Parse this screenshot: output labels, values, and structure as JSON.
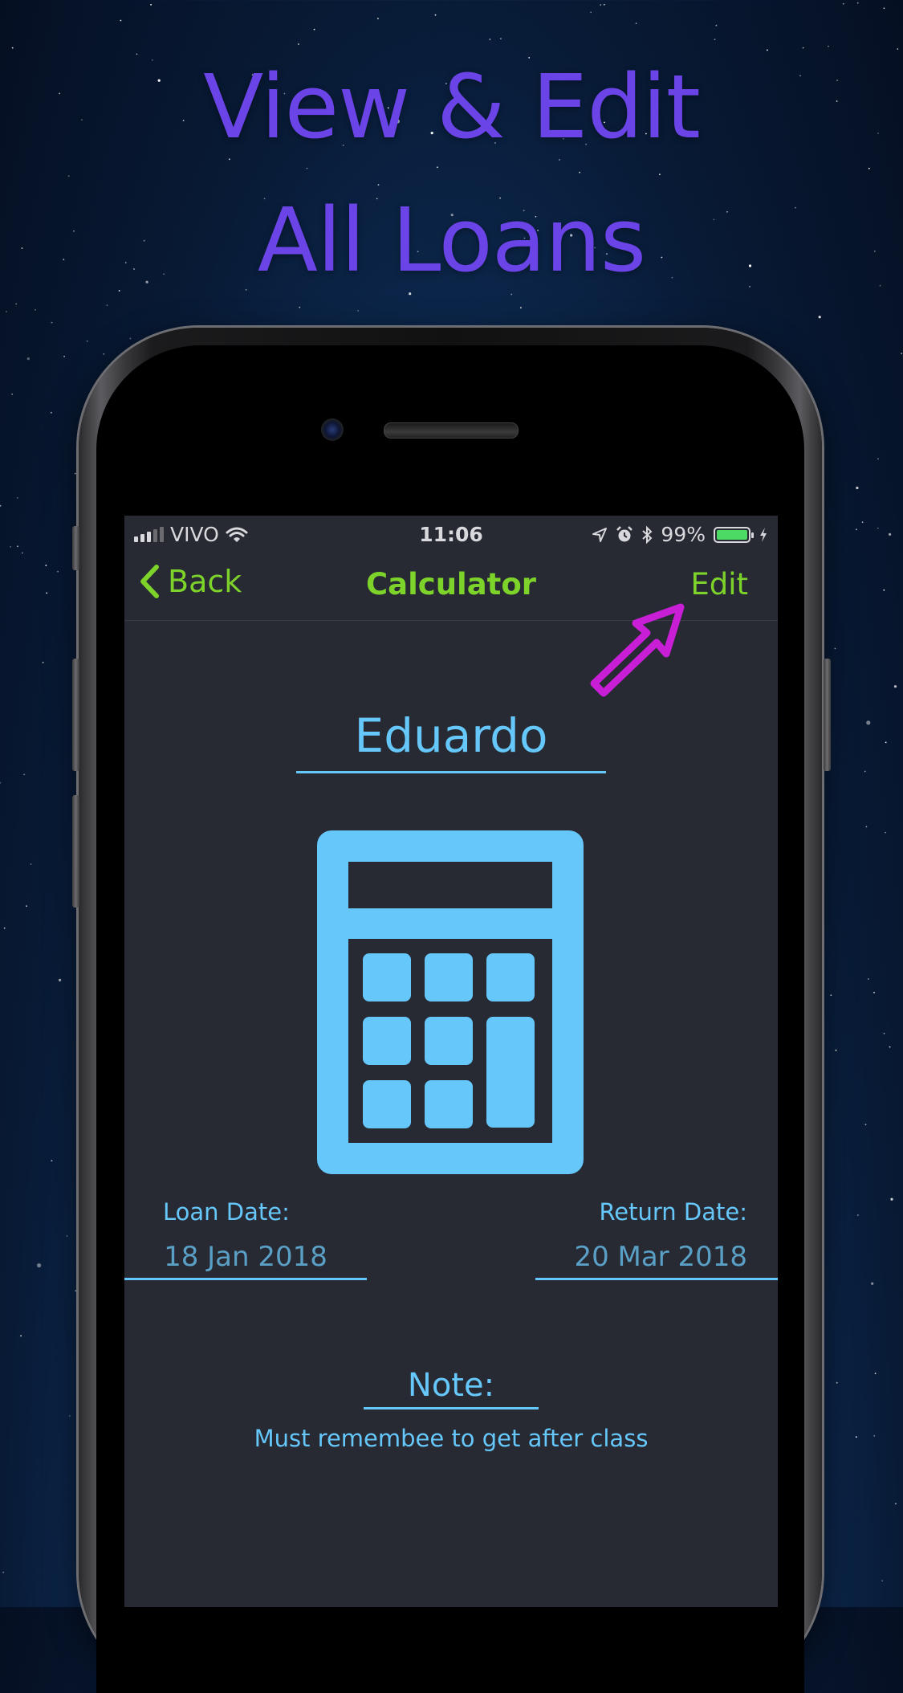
{
  "headline": {
    "line1": "View & Edit",
    "line2": "All Loans"
  },
  "colors": {
    "headline": "#6a44e6",
    "accent_green": "#7ed32b",
    "accent_blue": "#66c7fb",
    "screen_bg": "#272a33",
    "cursor_magenta": "#c81ed6"
  },
  "status_bar": {
    "carrier": "VIVO",
    "time": "11:06",
    "battery": "99%",
    "battery_level": 0.99,
    "icons": [
      "signal-icon",
      "wifi-icon",
      "location-icon",
      "alarm-icon",
      "bluetooth-icon",
      "battery-icon",
      "charging-icon"
    ]
  },
  "nav": {
    "back_label": "Back",
    "title": "Calculator",
    "edit_label": "Edit"
  },
  "loan": {
    "name": "Eduardo",
    "icon": "calculator-icon",
    "loan_date_label": "Loan Date:",
    "loan_date": "18 Jan 2018",
    "return_date_label": "Return Date:",
    "return_date": "20 Mar 2018",
    "note_label": "Note:",
    "note": "Must remembee to get after class"
  }
}
